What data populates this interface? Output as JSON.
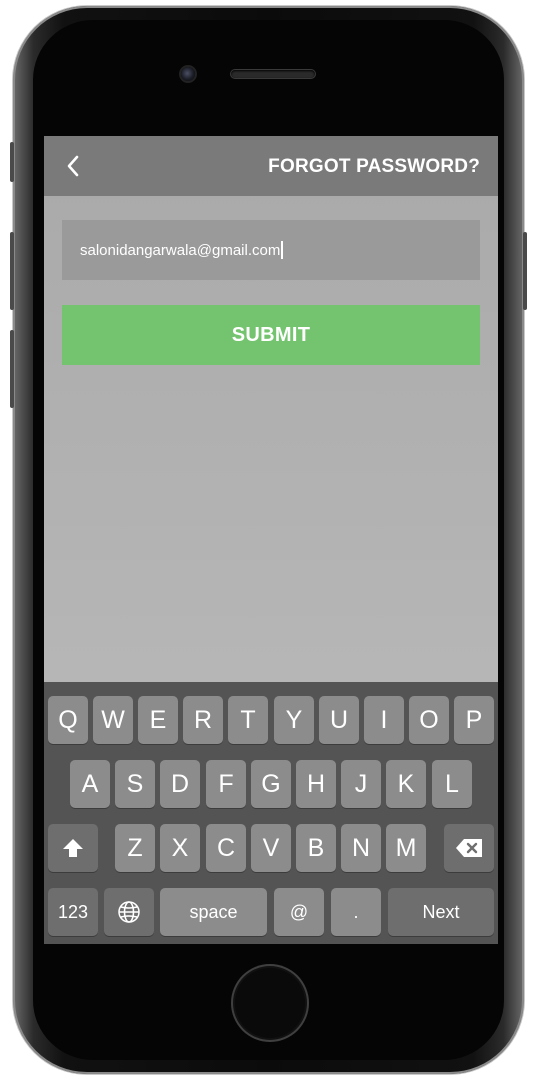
{
  "navbar": {
    "back_icon": "chevron-left-icon",
    "title": "FORGOT PASSWORD?"
  },
  "form": {
    "email_value": "salonidangarwala@gmail.com",
    "submit_label": "SUBMIT"
  },
  "keyboard": {
    "row1": [
      "Q",
      "W",
      "E",
      "R",
      "T",
      "Y",
      "U",
      "I",
      "O",
      "P"
    ],
    "row2": [
      "A",
      "S",
      "D",
      "F",
      "G",
      "H",
      "J",
      "K",
      "L"
    ],
    "row3": [
      "Z",
      "X",
      "C",
      "V",
      "B",
      "N",
      "M"
    ],
    "shift_icon": "shift-arrow-icon",
    "backspace_icon": "backspace-icon",
    "numbers_label": "123",
    "globe_icon": "globe-icon",
    "space_label": "space",
    "at_label": "@",
    "dot_label": ".",
    "next_label": "Next"
  },
  "colors": {
    "navbar": "#7a7a7a",
    "submit": "#74c46f",
    "keyboard": "#545454",
    "key": "#8c8c8c"
  }
}
